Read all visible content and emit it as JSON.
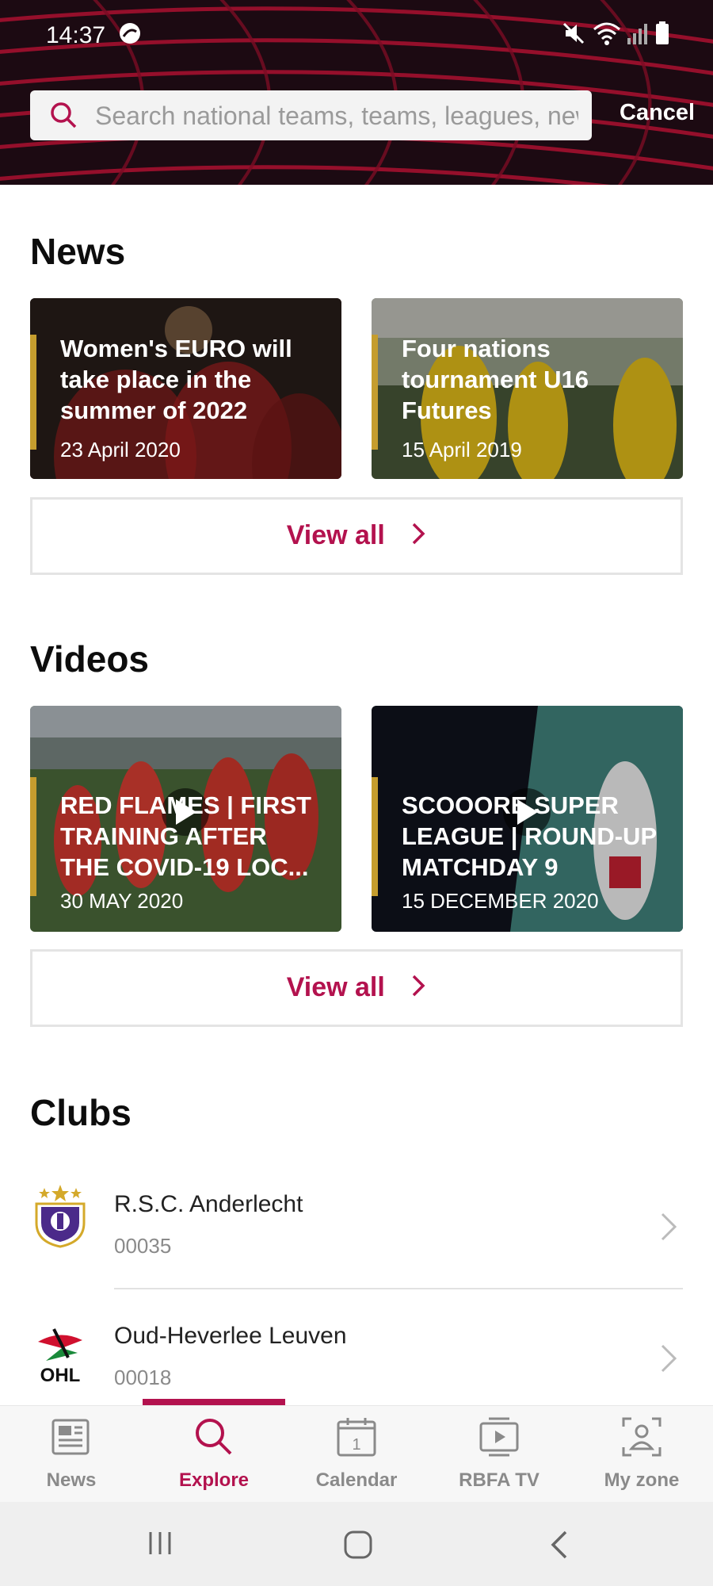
{
  "status_bar": {
    "time": "14:37"
  },
  "search": {
    "placeholder": "Search national teams, teams, leagues, news &",
    "cancel_label": "Cancel"
  },
  "news": {
    "title": "News",
    "items": [
      {
        "title": "Women's EURO will take place in the summer of 2022",
        "date": "23 April 2020"
      },
      {
        "title": "Four nations tournament U16 Futures",
        "date": "15 April 2019"
      }
    ],
    "view_all": "View all"
  },
  "videos": {
    "title": "Videos",
    "items": [
      {
        "title": "RED FLAMES | FIRST TRAINING AFTER THE COVID-19 LOC...",
        "date": "30 MAY 2020"
      },
      {
        "title": "SCOOORE SUPER LEAGUE | ROUND-UP MATCHDAY 9",
        "date": "15 DECEMBER 2020"
      }
    ],
    "view_all": "View all"
  },
  "clubs": {
    "title": "Clubs",
    "items": [
      {
        "name": "R.S.C. Anderlecht",
        "number": "00035"
      },
      {
        "name": "Oud-Heverlee Leuven",
        "number": "00018",
        "logo_text": "OHL"
      }
    ]
  },
  "bottom_nav": {
    "items": [
      {
        "label": "News",
        "icon": "newspaper-icon"
      },
      {
        "label": "Explore",
        "icon": "search-icon",
        "active": true
      },
      {
        "label": "Calendar",
        "icon": "calendar-icon"
      },
      {
        "label": "RBFA TV",
        "icon": "tv-icon"
      },
      {
        "label": "My zone",
        "icon": "user-icon"
      }
    ]
  },
  "calendar_icon_day": "1",
  "colors": {
    "accent": "#b3124e",
    "gold": "#c59d2e",
    "header_bg": "#1c0a12"
  }
}
